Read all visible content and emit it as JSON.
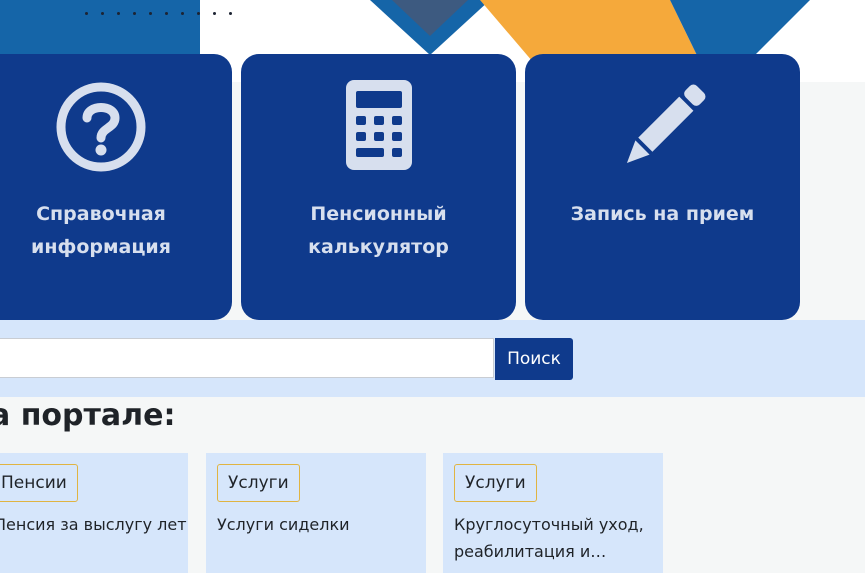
{
  "tiles": [
    {
      "label": "Справочная информация",
      "icon": "question-circle-icon"
    },
    {
      "label": "Пенсионный калькулятор",
      "icon": "calculator-icon"
    },
    {
      "label": "Запись на прием",
      "icon": "pencil-icon"
    }
  ],
  "search": {
    "placeholder": "",
    "value": "",
    "button_label": "Поиск"
  },
  "section": {
    "heading": "а портале:"
  },
  "cards": [
    {
      "tag": "Пенсии",
      "text": "Пенсия за выслугу лет"
    },
    {
      "tag": "Услуги",
      "text": "Услуги сиделки"
    },
    {
      "tag": "Услуги",
      "text": "Круглосуточный уход, реабилитация и…"
    }
  ],
  "colors": {
    "tile_bg": "#0f3a8c",
    "icon_fill": "#d7dfee",
    "band_bg": "#d6e6fb",
    "tag_border": "#e0b442",
    "accent_orange": "#f5a93b",
    "banner_blue": "#1565a8"
  }
}
